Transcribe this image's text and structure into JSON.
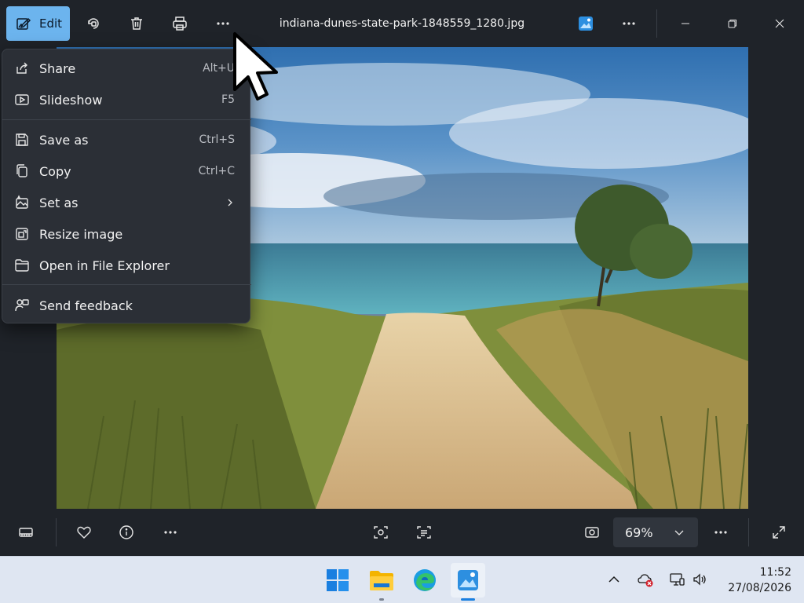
{
  "app": {
    "edit_label": "Edit",
    "file_title": "indiana-dunes-state-park-1848559_1280.jpg"
  },
  "toolbar": {
    "icons": [
      "edit-icon",
      "rotate-icon",
      "delete-icon",
      "print-icon",
      "more-icon",
      "photos-app-icon",
      "more-icon"
    ]
  },
  "menu": {
    "items": [
      {
        "label": "Share",
        "shortcut": "Alt+U",
        "icon": "share-icon"
      },
      {
        "label": "Slideshow",
        "shortcut": "F5",
        "icon": "slideshow-icon"
      },
      {
        "label": "Save as",
        "shortcut": "Ctrl+S",
        "icon": "save-icon"
      },
      {
        "label": "Copy",
        "shortcut": "Ctrl+C",
        "icon": "copy-icon"
      },
      {
        "label": "Set as",
        "shortcut": "",
        "icon": "set-as-icon"
      },
      {
        "label": "Resize image",
        "shortcut": "",
        "icon": "resize-icon"
      },
      {
        "label": "Open in File Explorer",
        "shortcut": "",
        "icon": "folder-icon"
      },
      {
        "label": "Send feedback",
        "shortcut": "",
        "icon": "feedback-icon"
      }
    ]
  },
  "bottombar": {
    "zoom_value": "69%",
    "icons": [
      "filmstrip-icon",
      "favorite-icon",
      "info-icon",
      "more-icon",
      "visual-search-icon",
      "text-scan-icon",
      "fit-icon",
      "more-icon",
      "fullscreen-icon"
    ]
  },
  "taskbar": {
    "time": "11:52",
    "date": "27/08/2026",
    "apps": [
      "windows-start-icon",
      "file-explorer-icon",
      "edge-icon",
      "photos-icon"
    ],
    "tray": [
      "show-hidden-icon",
      "onedrive-error-icon",
      "network-icon",
      "volume-icon"
    ]
  },
  "colors": {
    "accent": "#6cb4ee",
    "background": "#1f2329",
    "menu_bg": "#2b2f36",
    "taskbar_bg": "#dfe6f2"
  }
}
